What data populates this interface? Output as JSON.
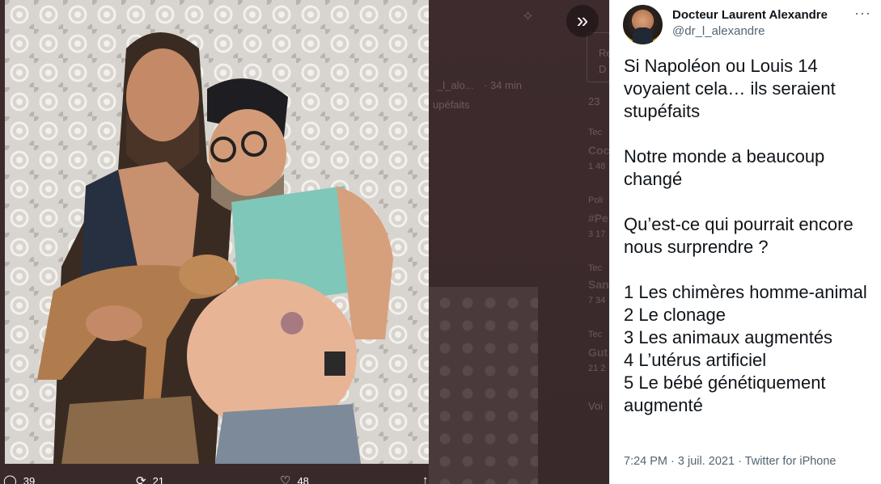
{
  "background": {
    "ghost_handle": "_l_alo...",
    "ghost_time": "· 34 min",
    "ghost_text": "upéfaits",
    "ghost_items": [
      "Re",
      "D",
      "23",
      "Tec",
      "Coc",
      "1 48",
      "Poli",
      "#Pe",
      "3 17",
      "Tec",
      "San",
      "7 34",
      "Tec",
      "Gut",
      "21 2",
      "Voi"
    ]
  },
  "media": {
    "description_icon": "photo",
    "next_icon": "double-chevron-right-icon"
  },
  "actions": {
    "reply_count": "39",
    "retweet_count": "21",
    "like_count": "48"
  },
  "tweet": {
    "display_name": "Docteur Laurent Alexandre",
    "handle": "@dr_l_alexandre",
    "more_label": "···",
    "paragraphs": [
      [
        "Si Napoléon ou Louis 14 voyaient cela… ils seraient stupéfaits"
      ],
      [
        "Notre monde a beaucoup changé"
      ],
      [
        "Qu’est-ce qui pourrait encore nous surprendre ?"
      ],
      [
        "1 Les chimères homme-animal",
        "2 Le clonage",
        "3 Les animaux augmentés",
        "4 L’utérus artificiel",
        "5 Le bébé génétiquement augmenté"
      ]
    ],
    "time": "7:24 PM",
    "date": "3 juil. 2021",
    "source": "Twitter for iPhone"
  },
  "colors": {
    "text_primary": "#0f1419",
    "text_secondary": "#536471",
    "backdrop": "#3b2a2c"
  }
}
